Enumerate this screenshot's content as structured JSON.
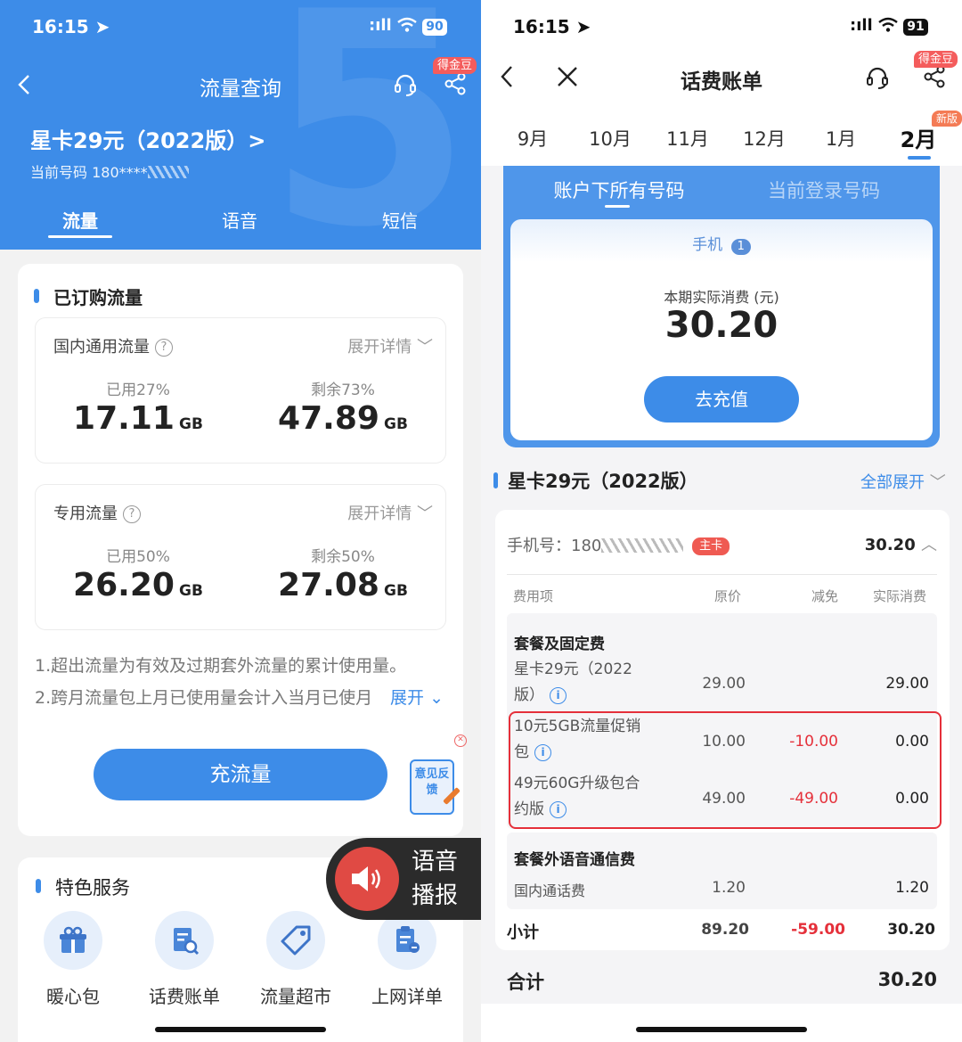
{
  "left": {
    "status": {
      "time": "16:15",
      "signal": ":ıll",
      "battery": "90"
    },
    "header": {
      "back_icon": "chevron-left-icon",
      "title": "流量查询",
      "badge": "得金豆",
      "plan_name": "星卡29元（2022版）>",
      "phone_label": "当前号码 180****",
      "tabs": [
        {
          "label": "流量",
          "active": true
        },
        {
          "label": "语音"
        },
        {
          "label": "短信"
        }
      ]
    },
    "subscribed": {
      "title": "已订购流量",
      "domestic": {
        "title": "国内通用流量",
        "expand": "展开详情",
        "used_label": "已用27%",
        "used_value": "17.11",
        "used_unit": "GB",
        "remain_label": "剩余73%",
        "remain_value": "47.89",
        "remain_unit": "GB"
      },
      "special": {
        "title": "专用流量",
        "expand": "展开详情",
        "used_label": "已用50%",
        "used_value": "26.20",
        "used_unit": "GB",
        "remain_label": "剩余50%",
        "remain_value": "27.08",
        "remain_unit": "GB"
      },
      "note1": "1.超出流量为有效及过期套外流量的累计使用量。",
      "note2": "2.跨月流量包上月已使用量会计入当月已使月",
      "note_expand": "展开",
      "recharge": "充流量",
      "feedback": "意见反馈"
    },
    "voice_broadcast": "语音播报",
    "services": {
      "title": "特色服务",
      "items": [
        {
          "label": "暖心包",
          "icon": "gift-icon"
        },
        {
          "label": "话费账单",
          "icon": "bill-search-icon"
        },
        {
          "label": "流量超市",
          "icon": "tag-icon"
        },
        {
          "label": "上网详单",
          "icon": "clipboard-icon"
        }
      ]
    }
  },
  "right": {
    "status": {
      "time": "16:15",
      "signal": ":ıll",
      "battery": "91"
    },
    "header": {
      "title": "话费账单",
      "badge": "得金豆"
    },
    "months": [
      {
        "label": "9月"
      },
      {
        "label": "10月"
      },
      {
        "label": "11月"
      },
      {
        "label": "12月"
      },
      {
        "label": "1月"
      },
      {
        "label": "2月",
        "active": true,
        "badge": "新版"
      }
    ],
    "account_tabs": [
      {
        "label": "账户下所有号码",
        "active": true
      },
      {
        "label": "当前登录号码"
      }
    ],
    "phone_tab": "手机",
    "phone_count": "1",
    "actual_label": "本期实际消费 (元)",
    "actual_amount": "30.20",
    "recharge": "去充值",
    "plan_title": "星卡29元（2022版）",
    "expand_all": "全部展开",
    "phone_number_label": "手机号：180",
    "main_card": "主卡",
    "phone_total": "30.20",
    "columns": [
      "费用项",
      "原价",
      "减免",
      "实际消费"
    ],
    "group1_title": "套餐及固定费",
    "rows": [
      {
        "name1": "星卡29元（2022",
        "name2": "版）",
        "orig": "29.00",
        "discount": "",
        "actual": "29.00"
      },
      {
        "name1": "10元5GB流量促销",
        "name2": "包",
        "orig": "10.00",
        "discount": "-10.00",
        "actual": "0.00"
      },
      {
        "name1": "49元60G升级包合",
        "name2": "约版",
        "orig": "49.00",
        "discount": "-49.00",
        "actual": "0.00"
      }
    ],
    "group2_title": "套餐外语音通信费",
    "voice_row": {
      "name": "国内通话费",
      "orig": "1.20",
      "actual": "1.20"
    },
    "subtotal": {
      "label": "小计",
      "orig": "89.20",
      "discount": "-59.00",
      "actual": "30.20"
    },
    "total": {
      "label": "合计",
      "value": "30.20"
    }
  }
}
